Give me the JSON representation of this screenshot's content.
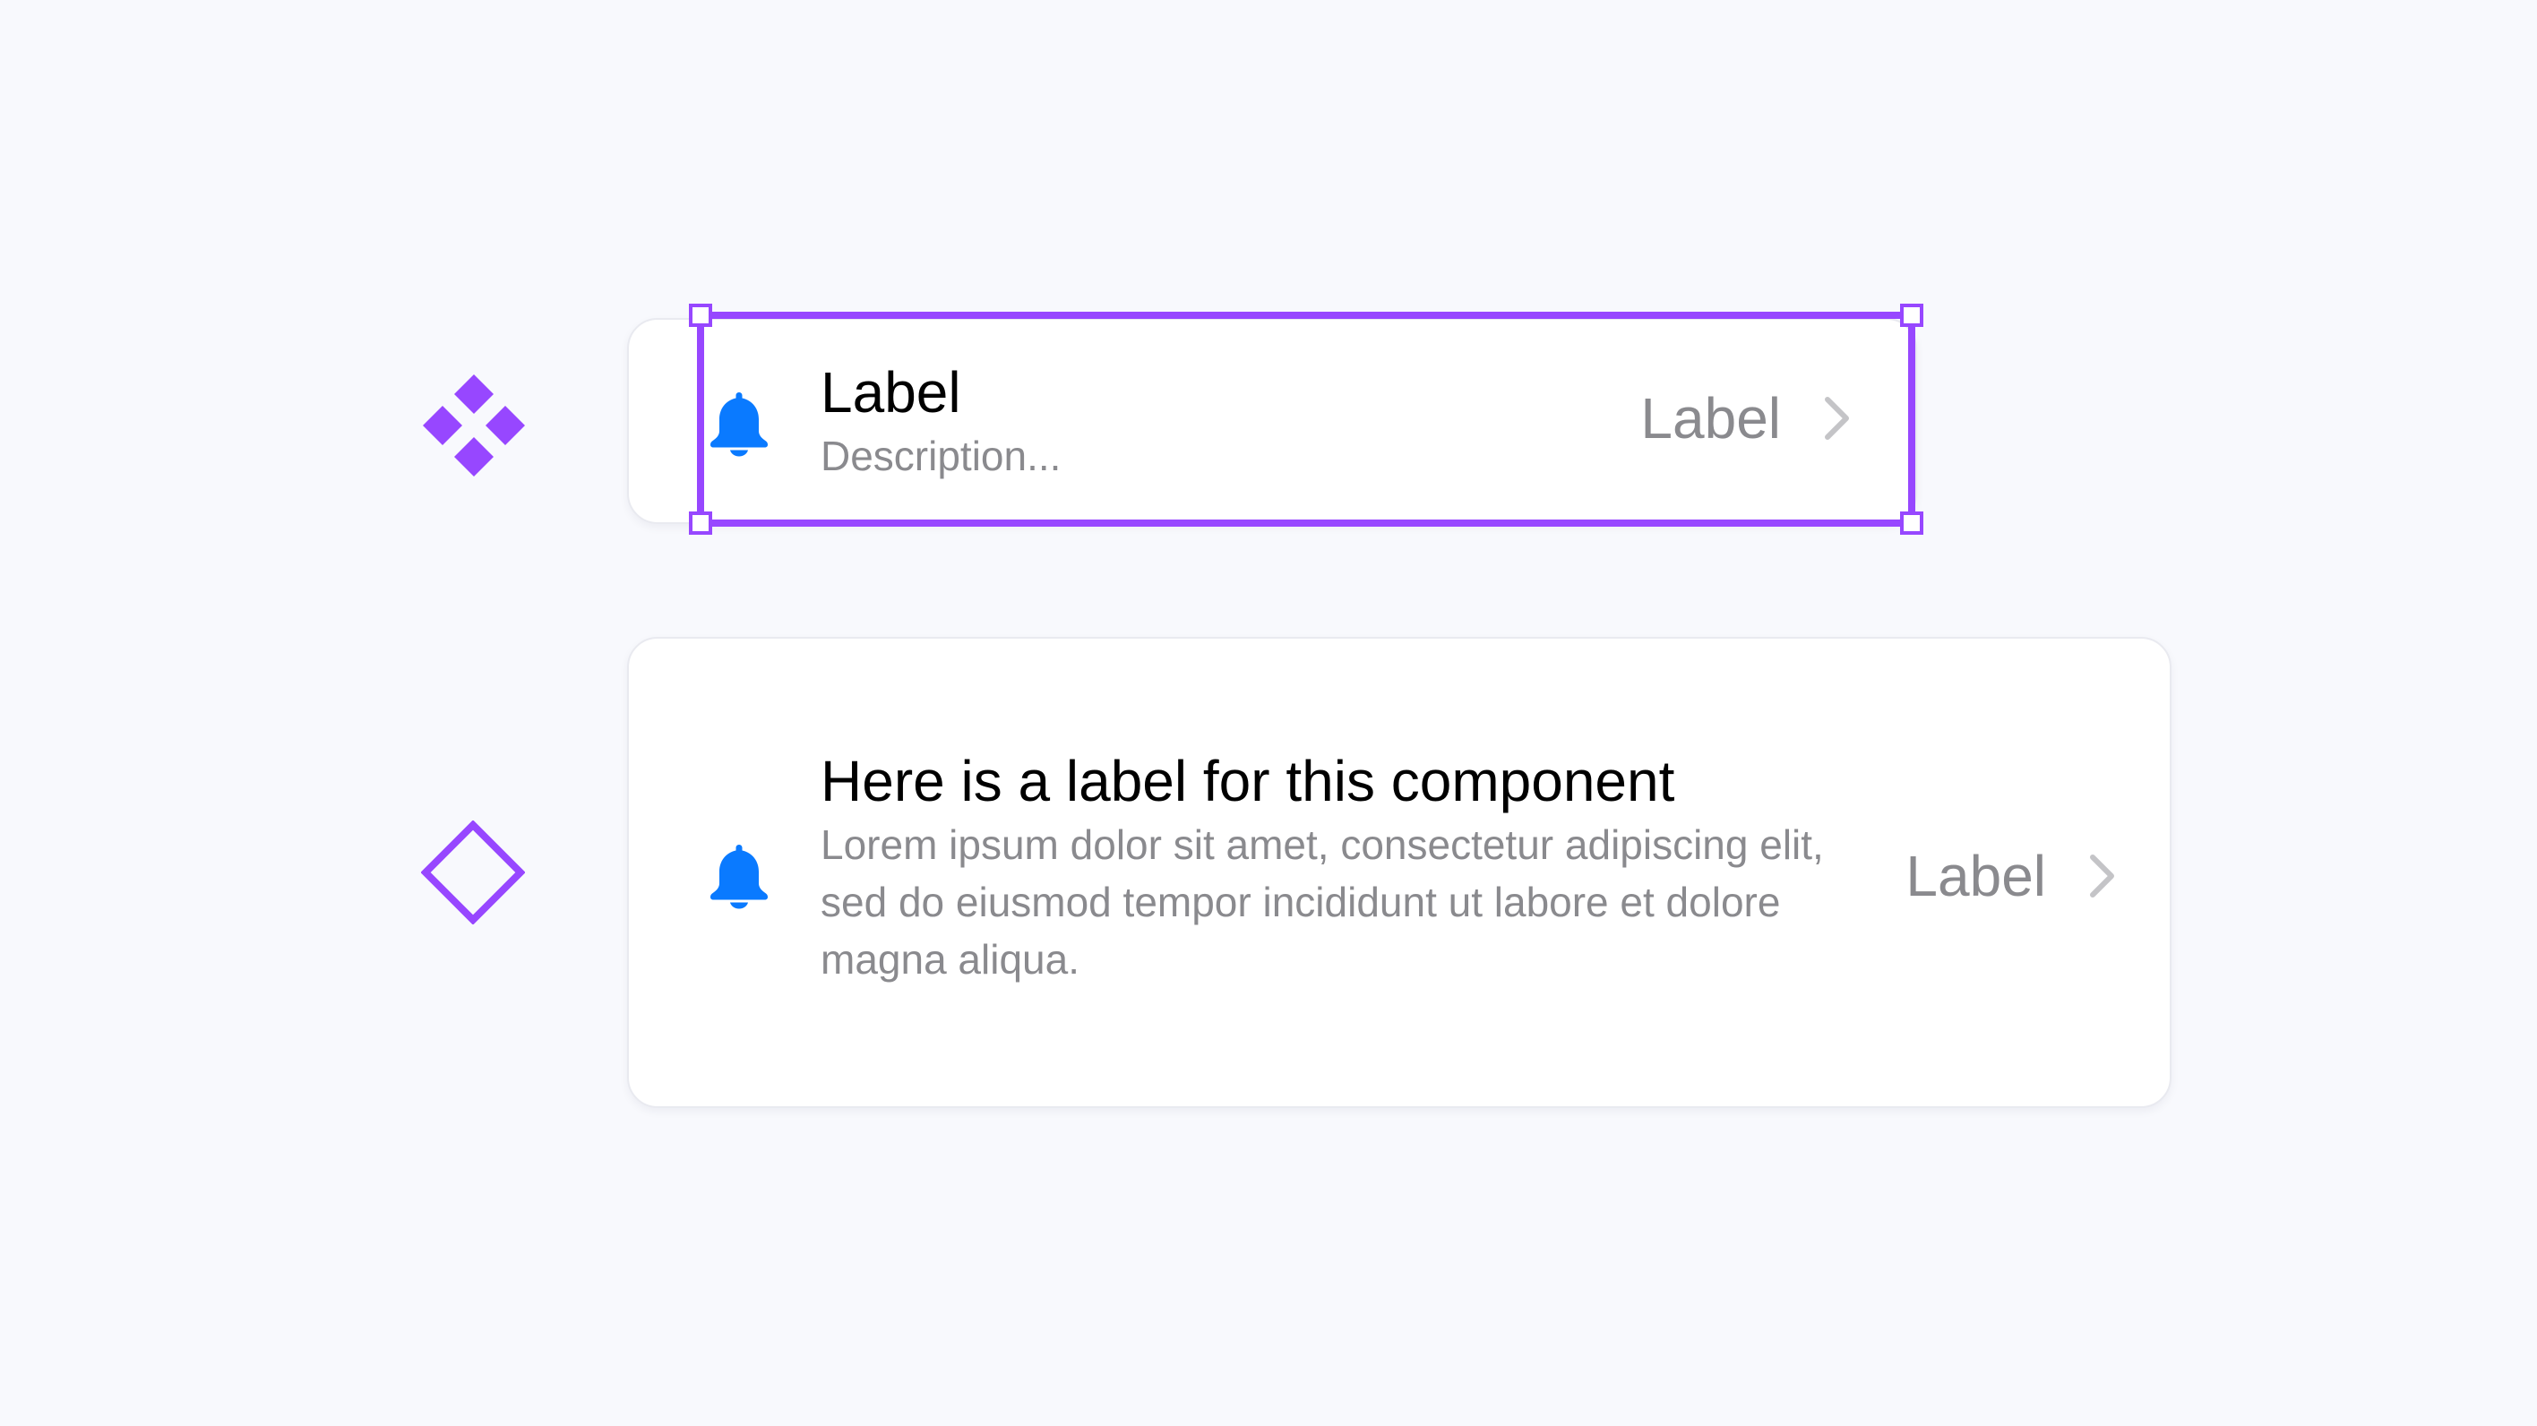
{
  "colors": {
    "background": "#F8F9FD",
    "card": "#FFFFFF",
    "accent_purple": "#9747FF",
    "icon_blue": "#0A7AFF",
    "text_primary": "#000000",
    "text_secondary": "#8A8A8E"
  },
  "markers": {
    "main_component_icon": "component-main-icon",
    "instance_icon": "component-instance-icon"
  },
  "list_items": [
    {
      "icon": "bell-icon",
      "title": "Label",
      "description": "Description...",
      "trailing_label": "Label",
      "trailing_icon": "chevron-right-icon",
      "selected": true
    },
    {
      "icon": "bell-icon",
      "title": "Here is a label for this component",
      "description": "Lorem ipsum dolor sit amet, consectetur adipiscing elit, sed do eiusmod tempor incididunt ut labore et dolore magna aliqua.",
      "trailing_label": "Label",
      "trailing_icon": "chevron-right-icon",
      "selected": false
    }
  ]
}
